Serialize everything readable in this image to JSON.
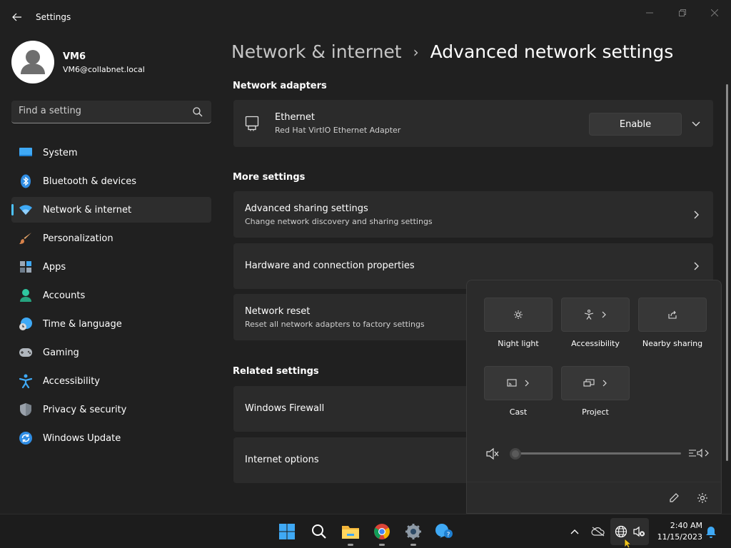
{
  "window": {
    "title": "Settings"
  },
  "profile": {
    "name": "VM6",
    "email": "VM6@collabnet.local"
  },
  "search": {
    "placeholder": "Find a setting"
  },
  "nav": {
    "items": [
      {
        "label": "System",
        "icon": "monitor-icon"
      },
      {
        "label": "Bluetooth & devices",
        "icon": "bluetooth-icon"
      },
      {
        "label": "Network & internet",
        "icon": "wifi-icon",
        "active": true
      },
      {
        "label": "Personalization",
        "icon": "brush-icon"
      },
      {
        "label": "Apps",
        "icon": "apps-icon"
      },
      {
        "label": "Accounts",
        "icon": "person-icon"
      },
      {
        "label": "Time & language",
        "icon": "globe-clock-icon"
      },
      {
        "label": "Gaming",
        "icon": "gamepad-icon"
      },
      {
        "label": "Accessibility",
        "icon": "accessibility-icon"
      },
      {
        "label": "Privacy & security",
        "icon": "shield-icon"
      },
      {
        "label": "Windows Update",
        "icon": "update-icon"
      }
    ]
  },
  "breadcrumb": {
    "parent": "Network & internet",
    "separator": "›",
    "current": "Advanced network settings"
  },
  "sections": {
    "adapters": {
      "title": "Network adapters",
      "ethernet": {
        "title": "Ethernet",
        "subtitle": "Red Hat VirtIO Ethernet Adapter",
        "button": "Enable"
      }
    },
    "more": {
      "title": "More settings",
      "items": [
        {
          "title": "Advanced sharing settings",
          "subtitle": "Change network discovery and sharing settings"
        },
        {
          "title": "Hardware and connection properties",
          "subtitle": ""
        },
        {
          "title": "Network reset",
          "subtitle": "Reset all network adapters to factory settings"
        }
      ]
    },
    "related": {
      "title": "Related settings",
      "items": [
        {
          "title": "Windows Firewall"
        },
        {
          "title": "Internet options"
        }
      ]
    }
  },
  "quick_settings": {
    "tiles": [
      {
        "label": "Night light",
        "icon": "night-light-icon",
        "has_arrow": false
      },
      {
        "label": "Accessibility",
        "icon": "accessibility-icon",
        "has_arrow": true
      },
      {
        "label": "Nearby sharing",
        "icon": "share-icon",
        "has_arrow": false
      },
      {
        "label": "Cast",
        "icon": "cast-icon",
        "has_arrow": true
      },
      {
        "label": "Project",
        "icon": "project-icon",
        "has_arrow": true
      }
    ],
    "volume": {
      "level": 0,
      "muted": true
    }
  },
  "taskbar": {
    "apps": [
      "start-icon",
      "search-icon",
      "file-explorer-icon",
      "chrome-icon",
      "settings-icon",
      "get-help-icon"
    ],
    "clock": {
      "time": "2:40 AM",
      "date": "11/15/2023"
    }
  },
  "colors": {
    "accent": "#4cc2ff",
    "background": "#202020",
    "card": "#2b2b2b"
  }
}
